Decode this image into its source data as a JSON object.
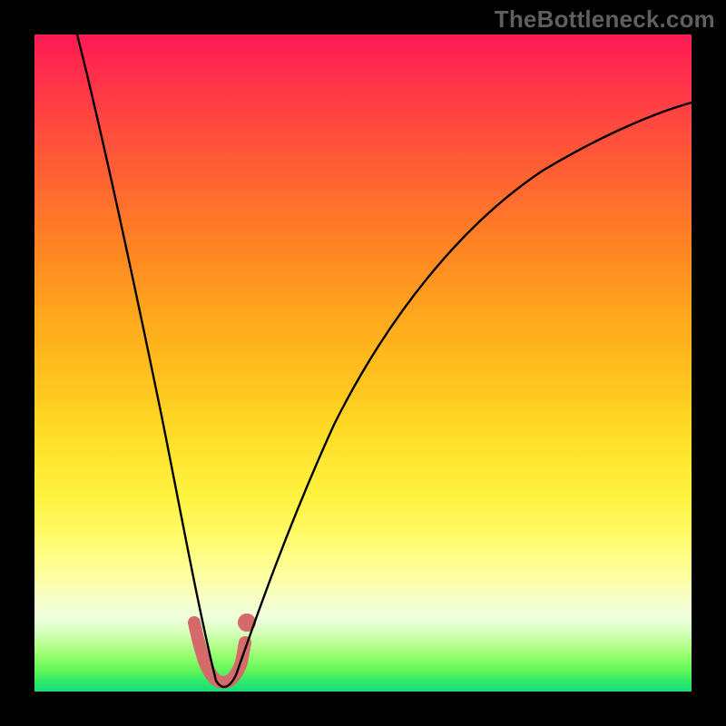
{
  "watermark": "TheBottleneck.com",
  "chart_data": {
    "type": "line",
    "title": "",
    "xlabel": "",
    "ylabel": "",
    "xlim": [
      0,
      100
    ],
    "ylim": [
      0,
      100
    ],
    "grid": false,
    "legend": false,
    "series": [
      {
        "name": "bottleneck-curve",
        "x": [
          5,
          8,
          10,
          12,
          15,
          18,
          20,
          22,
          24,
          25,
          26,
          27,
          28,
          30,
          32,
          35,
          38,
          42,
          46,
          50,
          55,
          60,
          66,
          73,
          80,
          88,
          96,
          100
        ],
        "y": [
          100,
          87,
          78,
          69,
          56,
          43,
          34,
          24,
          13,
          7,
          3,
          0,
          0,
          3,
          8,
          17,
          26,
          36,
          44,
          51,
          58,
          64,
          70,
          75,
          79,
          83,
          86,
          88
        ]
      }
    ],
    "accent_region": {
      "name": "recommended-range",
      "x": [
        24.5,
        25.5,
        26.5,
        28.0,
        29.0,
        30.0,
        31.0
      ],
      "y": [
        9,
        5,
        2,
        1,
        2,
        5,
        10
      ]
    },
    "colors": {
      "curve": "#000000",
      "accent": "#d46a6a",
      "gradient_top": "#ff1a52",
      "gradient_bottom": "#14df78"
    }
  }
}
